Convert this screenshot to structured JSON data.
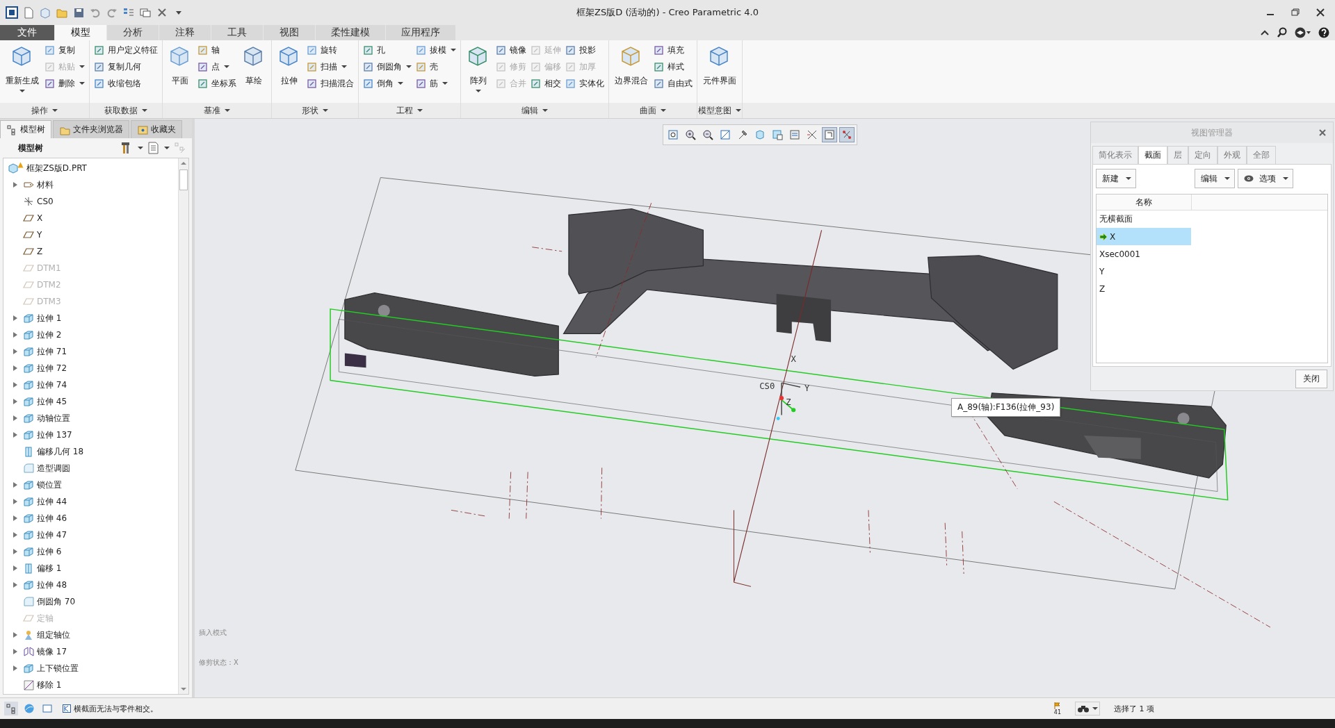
{
  "window": {
    "title": "框架ZS版D (活动的) - Creo Parametric 4.0"
  },
  "ribbon_tabs": [
    {
      "label": "文件",
      "kind": "file",
      "selected": false
    },
    {
      "label": "模型",
      "kind": "tab",
      "selected": true
    },
    {
      "label": "分析",
      "kind": "tab",
      "selected": false
    },
    {
      "label": "注释",
      "kind": "tab",
      "selected": false
    },
    {
      "label": "工具",
      "kind": "tab",
      "selected": false
    },
    {
      "label": "视图",
      "kind": "tab",
      "selected": false
    },
    {
      "label": "柔性建模",
      "kind": "tab",
      "selected": false
    },
    {
      "label": "应用程序",
      "kind": "tab",
      "selected": false
    }
  ],
  "ribbon_groups": [
    {
      "label": "操作",
      "items": [
        {
          "label": "重新生成",
          "kind": "large",
          "disabled": false,
          "dropdown": true
        },
        {
          "label": "复制",
          "kind": "small",
          "disabled": false,
          "dropdown": false
        },
        {
          "label": "粘贴",
          "kind": "small",
          "disabled": true,
          "dropdown": true
        },
        {
          "label": "删除",
          "kind": "small",
          "disabled": false,
          "dropdown": true
        }
      ]
    },
    {
      "label": "获取数据",
      "items": [
        {
          "label": "用户定义特征",
          "kind": "small",
          "disabled": false,
          "dropdown": false
        },
        {
          "label": "复制几何",
          "kind": "small",
          "disabled": false,
          "dropdown": false
        },
        {
          "label": "收缩包络",
          "kind": "small",
          "disabled": false,
          "dropdown": false
        }
      ]
    },
    {
      "label": "基准",
      "items": [
        {
          "label": "平面",
          "kind": "large",
          "disabled": false,
          "dropdown": false
        },
        {
          "label": "轴",
          "kind": "small",
          "disabled": false,
          "dropdown": false
        },
        {
          "label": "点",
          "kind": "small",
          "disabled": false,
          "dropdown": true
        },
        {
          "label": "坐标系",
          "kind": "small",
          "disabled": false,
          "dropdown": false
        },
        {
          "label": "草绘",
          "kind": "large",
          "disabled": false,
          "dropdown": false
        }
      ]
    },
    {
      "label": "形状",
      "items": [
        {
          "label": "拉伸",
          "kind": "large",
          "disabled": false,
          "dropdown": false
        },
        {
          "label": "旋转",
          "kind": "small",
          "disabled": false,
          "dropdown": false
        },
        {
          "label": "扫描",
          "kind": "small",
          "disabled": false,
          "dropdown": true
        },
        {
          "label": "扫描混合",
          "kind": "small",
          "disabled": false,
          "dropdown": false
        }
      ]
    },
    {
      "label": "工程",
      "items": [
        {
          "label": "孔",
          "kind": "small",
          "disabled": false,
          "dropdown": false
        },
        {
          "label": "倒圆角",
          "kind": "small",
          "disabled": false,
          "dropdown": true
        },
        {
          "label": "倒角",
          "kind": "small",
          "disabled": false,
          "dropdown": true
        },
        {
          "label": "拔模",
          "kind": "small",
          "disabled": false,
          "dropdown": true
        },
        {
          "label": "壳",
          "kind": "small",
          "disabled": false,
          "dropdown": false
        },
        {
          "label": "筋",
          "kind": "small",
          "disabled": false,
          "dropdown": true
        }
      ]
    },
    {
      "label": "编辑",
      "items": [
        {
          "label": "阵列",
          "kind": "large",
          "disabled": false,
          "dropdown": true
        },
        {
          "label": "镜像",
          "kind": "small",
          "disabled": false,
          "dropdown": false
        },
        {
          "label": "修剪",
          "kind": "small",
          "disabled": true,
          "dropdown": false
        },
        {
          "label": "合并",
          "kind": "small",
          "disabled": true,
          "dropdown": false
        },
        {
          "label": "延伸",
          "kind": "small",
          "disabled": true,
          "dropdown": false
        },
        {
          "label": "偏移",
          "kind": "small",
          "disabled": true,
          "dropdown": false
        },
        {
          "label": "相交",
          "kind": "small",
          "disabled": false,
          "dropdown": false
        },
        {
          "label": "投影",
          "kind": "small",
          "disabled": false,
          "dropdown": false
        },
        {
          "label": "加厚",
          "kind": "small",
          "disabled": true,
          "dropdown": false
        },
        {
          "label": "实体化",
          "kind": "small",
          "disabled": false,
          "dropdown": false
        }
      ]
    },
    {
      "label": "曲面",
      "items": [
        {
          "label": "边界混合",
          "kind": "large",
          "disabled": false,
          "dropdown": false
        },
        {
          "label": "填充",
          "kind": "small",
          "disabled": false,
          "dropdown": false
        },
        {
          "label": "样式",
          "kind": "small",
          "disabled": false,
          "dropdown": false
        },
        {
          "label": "自由式",
          "kind": "small",
          "disabled": false,
          "dropdown": false
        }
      ]
    },
    {
      "label": "模型意图",
      "items": [
        {
          "label": "元件界面",
          "kind": "large",
          "disabled": false,
          "dropdown": false
        }
      ]
    }
  ],
  "panel_tabs": [
    {
      "label": "模型树",
      "selected": true
    },
    {
      "label": "文件夹浏览器",
      "selected": false
    },
    {
      "label": "收藏夹",
      "selected": false
    }
  ],
  "model_tree": {
    "title": "模型树",
    "root": {
      "label": "框架ZS版D.PRT",
      "warning": true,
      "children": [
        {
          "label": "材料",
          "kind": "material",
          "expandable": true,
          "disabled": false
        },
        {
          "label": "CS0",
          "kind": "csys",
          "expandable": false,
          "disabled": false
        },
        {
          "label": "X",
          "kind": "plane",
          "expandable": false,
          "disabled": false
        },
        {
          "label": "Y",
          "kind": "plane",
          "expandable": false,
          "disabled": false
        },
        {
          "label": "Z",
          "kind": "plane",
          "expandable": false,
          "disabled": false
        },
        {
          "label": "DTM1",
          "kind": "plane",
          "expandable": false,
          "disabled": true
        },
        {
          "label": "DTM2",
          "kind": "plane",
          "expandable": false,
          "disabled": true
        },
        {
          "label": "DTM3",
          "kind": "plane",
          "expandable": false,
          "disabled": true
        },
        {
          "label": "拉伸 1",
          "kind": "extrude",
          "expandable": true,
          "disabled": false
        },
        {
          "label": "拉伸 2",
          "kind": "extrude",
          "expandable": true,
          "disabled": false
        },
        {
          "label": "拉伸 71",
          "kind": "extrude",
          "expandable": true,
          "disabled": false
        },
        {
          "label": "拉伸 72",
          "kind": "extrude",
          "expandable": true,
          "disabled": false
        },
        {
          "label": "拉伸 74",
          "kind": "extrude",
          "expandable": true,
          "disabled": false
        },
        {
          "label": "拉伸 45",
          "kind": "extrude",
          "expandable": true,
          "disabled": false
        },
        {
          "label": "动轴位置",
          "kind": "extrude",
          "expandable": true,
          "disabled": false
        },
        {
          "label": "拉伸 137",
          "kind": "extrude",
          "expandable": true,
          "disabled": false
        },
        {
          "label": "偏移几何 18",
          "kind": "offset",
          "expandable": false,
          "disabled": false
        },
        {
          "label": "造型调圆",
          "kind": "round",
          "expandable": false,
          "disabled": false
        },
        {
          "label": "锁位置",
          "kind": "extrude",
          "expandable": true,
          "disabled": false
        },
        {
          "label": "拉伸 44",
          "kind": "extrude",
          "expandable": true,
          "disabled": false
        },
        {
          "label": "拉伸 46",
          "kind": "extrude",
          "expandable": true,
          "disabled": false
        },
        {
          "label": "拉伸 47",
          "kind": "extrude",
          "expandable": true,
          "disabled": false
        },
        {
          "label": "拉伸 6",
          "kind": "extrude",
          "expandable": true,
          "disabled": false
        },
        {
          "label": "偏移 1",
          "kind": "offset",
          "expandable": true,
          "disabled": false
        },
        {
          "label": "拉伸 48",
          "kind": "extrude",
          "expandable": true,
          "disabled": false
        },
        {
          "label": "倒圆角 70",
          "kind": "round",
          "expandable": false,
          "disabled": false
        },
        {
          "label": "定轴",
          "kind": "plane",
          "expandable": false,
          "disabled": true
        },
        {
          "label": "组定轴位",
          "kind": "group",
          "expandable": true,
          "disabled": false
        },
        {
          "label": "镜像 17",
          "kind": "mirror",
          "expandable": true,
          "disabled": false
        },
        {
          "label": "上下锁位置",
          "kind": "extrude",
          "expandable": true,
          "disabled": false
        },
        {
          "label": "移除 1",
          "kind": "remove",
          "expandable": false,
          "disabled": false
        }
      ]
    }
  },
  "view_toolbar": [
    {
      "pressed": false
    },
    {
      "pressed": false
    },
    {
      "pressed": false
    },
    {
      "pressed": false
    },
    {
      "pressed": false
    },
    {
      "pressed": false
    },
    {
      "pressed": false
    },
    {
      "pressed": false
    },
    {
      "pressed": false
    },
    {
      "pressed": true
    },
    {
      "pressed": true
    }
  ],
  "viewport": {
    "mode_text": "插入模式",
    "state_text": "修剪状态：X",
    "tooltip": "A_89(轴):F136(拉伸_93)",
    "csys_labels": [
      "CS0",
      "X",
      "Y",
      "Z"
    ]
  },
  "view_manager": {
    "title": "视图管理器",
    "tabs": [
      {
        "label": "简化表示",
        "selected": false
      },
      {
        "label": "截面",
        "selected": true
      },
      {
        "label": "层",
        "selected": false
      },
      {
        "label": "定向",
        "selected": false
      },
      {
        "label": "外观",
        "selected": false
      },
      {
        "label": "全部",
        "selected": false
      }
    ],
    "buttons": [
      {
        "label": "新建",
        "kind": "menu"
      },
      {
        "label": "编辑",
        "kind": "menu"
      },
      {
        "label": "选项",
        "kind": "eye"
      }
    ],
    "table": {
      "columns": [
        "名称"
      ],
      "rows": [
        {
          "name": "无横截面",
          "selected": false,
          "active": false
        },
        {
          "name": "X",
          "selected": true,
          "active": true
        },
        {
          "name": "Xsec0001",
          "selected": false,
          "active": false
        },
        {
          "name": "Y",
          "selected": false,
          "active": false
        },
        {
          "name": "Z",
          "selected": false,
          "active": false
        }
      ]
    },
    "close_button": "关闭"
  },
  "status_bar": {
    "message": "横截面无法与零件相交。",
    "flag_count": "41",
    "selection": "选择了 1 项"
  }
}
